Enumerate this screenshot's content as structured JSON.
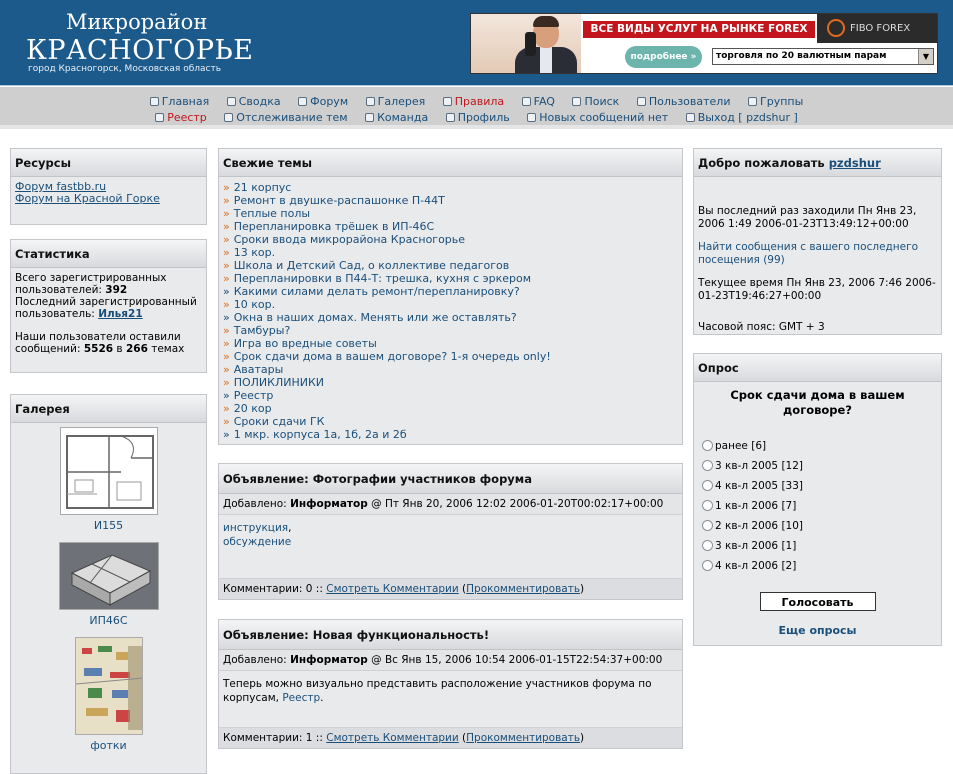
{
  "header": {
    "title_small": "Микрорайон",
    "title_big": "КРАСНОГОРЬЕ",
    "subtitle": "город Красногорск, Московская область"
  },
  "banner": {
    "headline": "ВСЕ ВИДЫ УСЛУГ НА РЫНКЕ FOREX",
    "more_button": "подробнее »",
    "select_value": "торговля по 20 валютным парам",
    "brand": "FIBO FOREX"
  },
  "nav": {
    "row1": [
      "Главная",
      "Сводка",
      "Форум",
      "Галерея",
      "Правила",
      "FAQ",
      "Поиск",
      "Пользователи",
      "Группы"
    ],
    "row2": [
      "Реестр",
      "Отслеживание тем",
      "Команда",
      "Профиль",
      "Новых сообщений нет",
      "Выход [ pzdshur ]"
    ]
  },
  "resources": {
    "title": "Ресурсы",
    "links": [
      "Форум fastbb.ru",
      "Форум на Красной Горке"
    ]
  },
  "stats": {
    "title": "Статистика",
    "line1": "Всего зарегистрированных пользователей:",
    "total_users": "392",
    "line2": "Последний зарегистрированный пользователь:",
    "last_user": "Илья21",
    "line3": "Наши пользователи оставили сообщений:",
    "messages": "5526",
    "in": "в",
    "topics": "266",
    "topics_word": "темах"
  },
  "gallery": {
    "title": "Галерея",
    "items": [
      "И155",
      "ИП46С",
      "фотки"
    ]
  },
  "topics": {
    "title": "Свежие темы",
    "items": [
      "21 корпус",
      "Ремонт в двушке-распашонке П-44Т",
      "Теплые полы",
      "Перепланировка трёшек в ИП-46С",
      "Сроки ввода микрорайона Красногорье",
      "13 кор.",
      "Школа и Детский Сад, о коллективе педагогов",
      "Перепланировки в П44-Т: трешка, кухня с эркером",
      "Какими силами делать ремонт/перепланировку?",
      "10 кор.",
      "Окна в наших домах. Менять или же оставлять?",
      "Тамбуры?",
      "Игра во вредные советы",
      "Срок сдачи дома в вашем договоре? 1-я очередь only!",
      "Аватары",
      "ПОЛИКЛИНИКИ",
      "Реестр",
      "20 кор",
      "Сроки сдачи ГК",
      "1 мкр. корпуса 1а, 1б, 2а и 2б"
    ]
  },
  "ann1": {
    "title": "Объявление: Фотографии участников форума",
    "added": "Добавлено:",
    "author": "Информатор",
    "date": "@ Пт Янв 20, 2006 12:02 2006-01-20T00:02:17+00:00",
    "body_link1": "инструкция",
    "body_link2": "обсуждение",
    "comments": "Комментарии: 0 ::",
    "view_comments": "Смотреть Комментарии",
    "comment": "Прокомментировать"
  },
  "ann2": {
    "title": "Объявление: Новая функциональность!",
    "added": "Добавлено:",
    "author": "Информатор",
    "date": "@ Вс Янв 15, 2006 10:54 2006-01-15T22:54:37+00:00",
    "body": "Теперь можно визуально представить расположение участников форума по корпусам,",
    "body_link": "Реестр",
    "comments": "Комментарии: 1 ::",
    "view_comments": "Смотреть Комментарии",
    "comment": "Прокомментировать"
  },
  "welcome": {
    "title": "Добро пожаловать",
    "user": "pzdshur",
    "last_visit": "Вы последний раз заходили Пн Янв 23, 2006 1:49 2006-01-23T13:49:12+00:00",
    "find_posts": "Найти сообщения с вашего последнего посещения (99)",
    "current_time": "Текущее время Пн Янв 23, 2006 7:46 2006-01-23T19:46:27+00:00",
    "timezone": "Часовой пояс: GMT + 3"
  },
  "poll": {
    "title": "Опрос",
    "question": "Срок сдачи дома в вашем договоре?",
    "options": [
      "ранее [6]",
      "3 кв-л 2005 [12]",
      "4 кв-л 2005 [33]",
      "1 кв-л 2006 [7]",
      "2 кв-л 2006 [10]",
      "3 кв-л 2006 [1]",
      "4 кв-л 2006 [2]"
    ],
    "vote_button": "Голосовать",
    "more": "Еще опросы"
  }
}
